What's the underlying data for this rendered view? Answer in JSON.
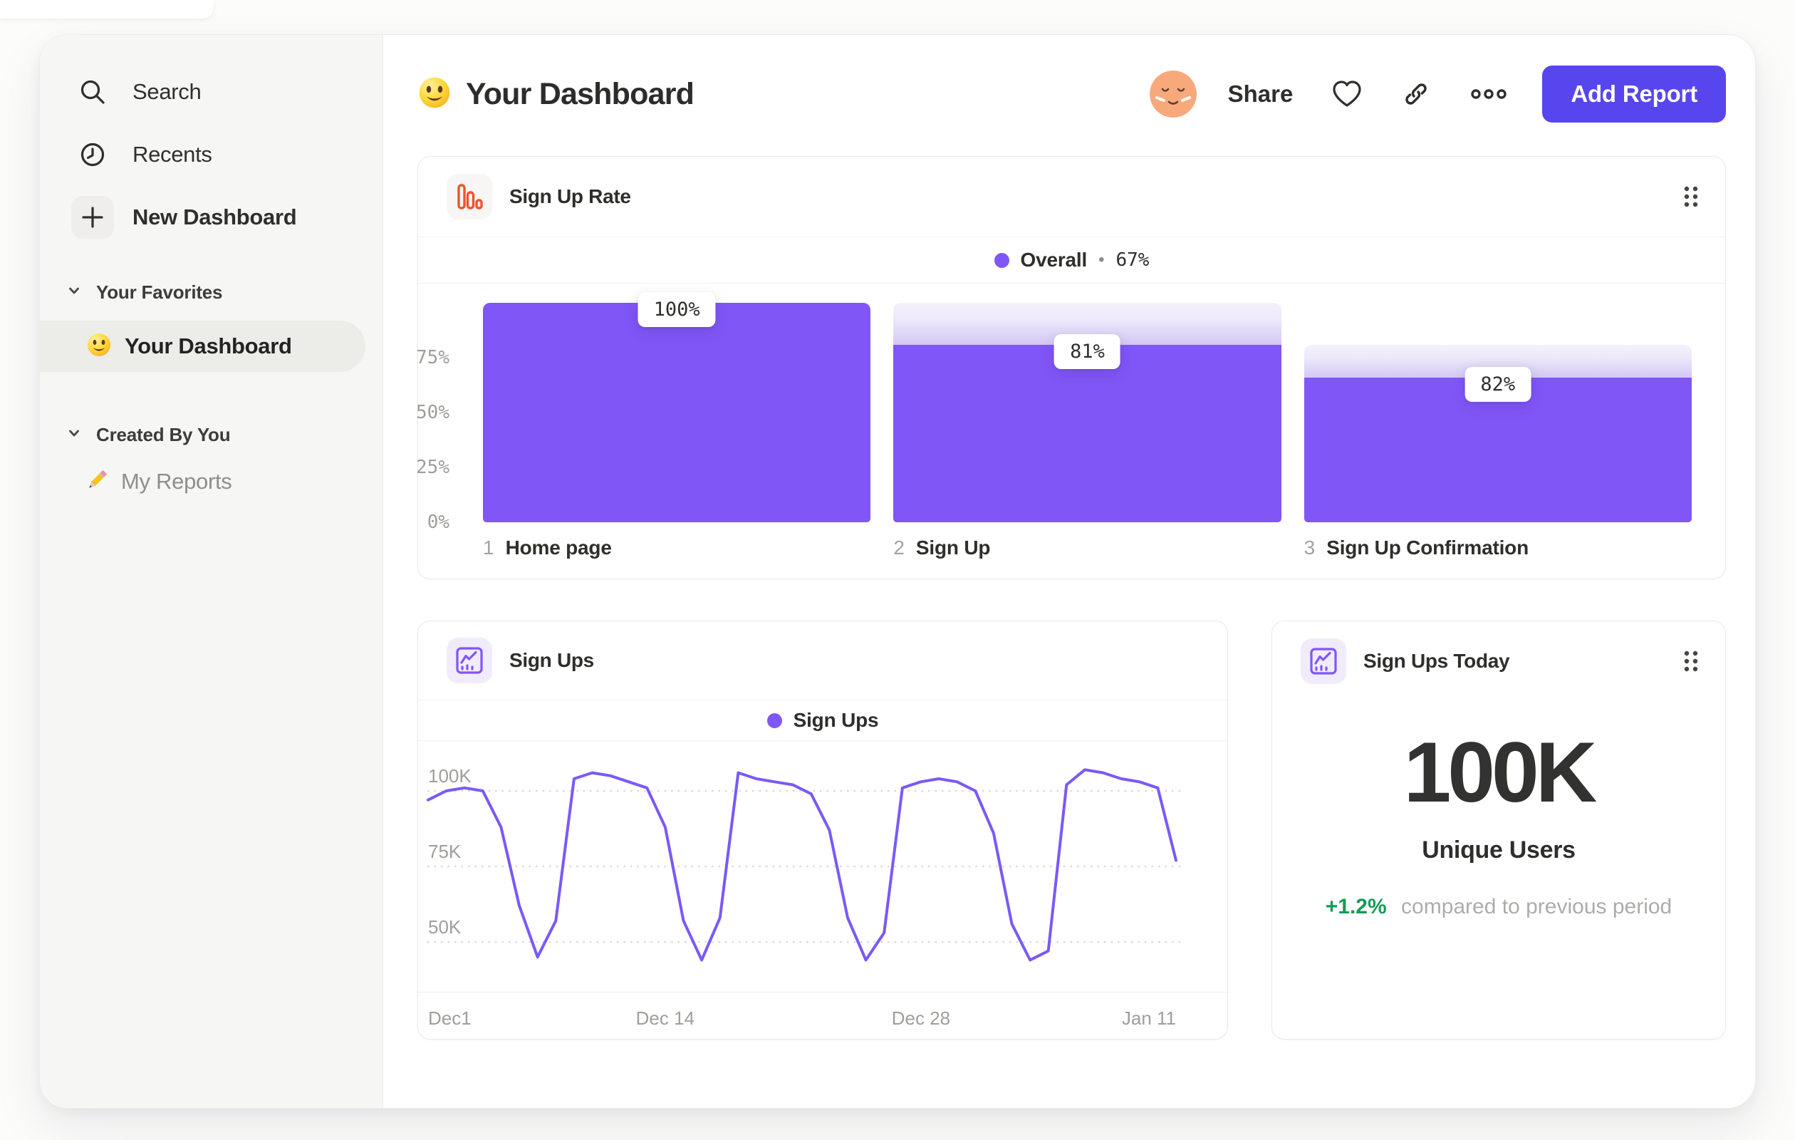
{
  "header": {
    "title": "Your Dashboard",
    "title_emoji": "smiley-face",
    "share_label": "Share",
    "add_report_label": "Add Report",
    "action_icons": [
      "avatar",
      "heart-icon",
      "link-icon",
      "more-icon"
    ]
  },
  "sidebar": {
    "items": [
      {
        "label": "Search",
        "icon": "search-icon"
      },
      {
        "label": "Recents",
        "icon": "clock-icon"
      },
      {
        "label": "New Dashboard",
        "icon": "plus-icon"
      }
    ],
    "sections": [
      {
        "label": "Your Favorites",
        "icon": "chevron-down-icon",
        "items": [
          {
            "label": "Your Dashboard",
            "icon": "smiley-emoji",
            "selected": true
          }
        ]
      },
      {
        "label": "Created By You",
        "icon": "chevron-down-icon",
        "items": [
          {
            "label": "My Reports",
            "icon": "pencil-emoji",
            "selected": false
          }
        ]
      }
    ]
  },
  "chart_data": [
    {
      "id": "sign-up-rate-funnel",
      "type": "bar",
      "subtype": "funnel",
      "title": "Sign Up Rate",
      "legend": {
        "label": "Overall",
        "separator": "•",
        "value": "67%"
      },
      "ylim": [
        0,
        100
      ],
      "y_ticks": [
        {
          "label": "75%",
          "value": 75
        },
        {
          "label": "50%",
          "value": 50
        },
        {
          "label": "25%",
          "value": 25
        },
        {
          "label": "0%",
          "value": 0
        }
      ],
      "steps": [
        {
          "index": "1",
          "name": "Home page",
          "label": "100%",
          "overall_pct": 100,
          "prev_pct": 100
        },
        {
          "index": "2",
          "name": "Sign Up",
          "label": "81%",
          "overall_pct": 81,
          "prev_pct": 100
        },
        {
          "index": "3",
          "name": "Sign Up Confirmation",
          "label": "82%",
          "overall_pct": 66,
          "prev_pct": 81
        }
      ],
      "bar_color": "#8156F7",
      "fade_gradient": [
        "#F4F1FC",
        "#D2C8F5"
      ],
      "grid": "off",
      "legend_position": "top-center"
    },
    {
      "id": "sign-ups-line",
      "type": "line",
      "title": "Sign Ups",
      "legend": {
        "label": "Sign Ups"
      },
      "line_color": "#7A59F7",
      "grid": "dotted-horizontal",
      "legend_position": "top-center",
      "y_ticks": [
        {
          "label": "100K",
          "value": 100
        },
        {
          "label": "75K",
          "value": 75
        },
        {
          "label": "50K",
          "value": 50
        }
      ],
      "x_ticks": [
        {
          "label": "Dec1",
          "pos": 0,
          "align": "left"
        },
        {
          "label": "Dec 14",
          "pos": 0.317,
          "align": "center"
        },
        {
          "label": "Dec 28",
          "pos": 0.659,
          "align": "center"
        },
        {
          "label": "Jan 11",
          "pos": 1,
          "align": "right"
        }
      ],
      "y_unit": "K",
      "series": [
        {
          "name": "Sign Ups",
          "values": [
            97,
            100,
            101,
            100,
            88,
            62,
            45,
            57,
            104,
            106,
            105,
            103,
            101,
            88,
            57,
            44,
            58,
            106,
            104,
            103,
            102,
            99,
            87,
            58,
            44,
            53,
            101,
            103,
            104,
            103,
            100,
            86,
            56,
            44,
            47,
            102,
            107,
            106,
            104,
            103,
            101,
            77
          ]
        }
      ]
    },
    {
      "id": "sign-ups-today-metric",
      "type": "metric",
      "title": "Sign Ups Today",
      "value": "100K",
      "label": "Unique Users",
      "delta": "+1.2%",
      "delta_positive": true,
      "compare_text": "compared to previous period"
    }
  ],
  "colors": {
    "accent_purple": "#8156F7",
    "line_purple": "#7A59F7",
    "button_indigo": "#5746EE",
    "positive_green": "#149B57",
    "icon_orange": "#F0532D",
    "sidebar_bg": "#F6F6F4",
    "selected_pill": "#ECECE9"
  }
}
